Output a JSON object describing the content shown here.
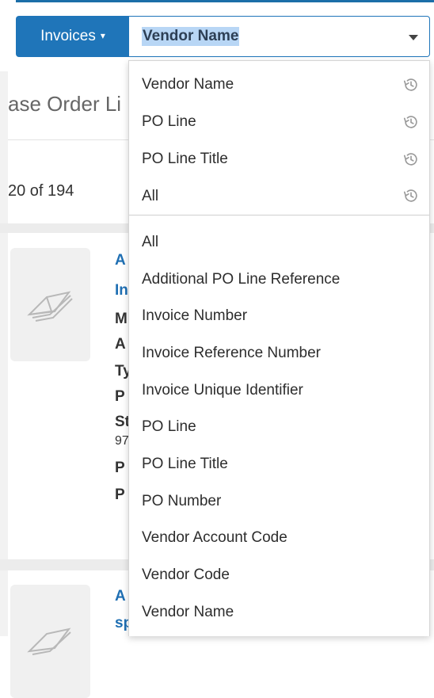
{
  "search": {
    "scope_label": "Invoices",
    "scope_caret": "▾",
    "selected_field": "Vendor Name"
  },
  "background": {
    "heading_fragment": "ase Order Li",
    "count_fragment": "20 of 194",
    "result1": {
      "title_line1": "A",
      "title_line2": "In",
      "fields": [
        "M",
        "A",
        "Ty",
        "P",
        "St",
        "97",
        "P",
        "P"
      ]
    },
    "result2": {
      "title_line1": "A",
      "title_line2": "sp"
    }
  },
  "dropdown": {
    "recent_items": [
      {
        "label": "Vendor Name",
        "icon": "history-icon"
      },
      {
        "label": "PO Line",
        "icon": "history-icon"
      },
      {
        "label": "PO Line Title",
        "icon": "history-icon"
      },
      {
        "label": "All",
        "icon": "history-icon"
      }
    ],
    "field_items": [
      "All",
      "Additional PO Line Reference",
      "Invoice Number",
      "Invoice Reference Number",
      "Invoice Unique Identifier",
      "PO Line",
      "PO Line Title",
      "PO Number",
      "Vendor Account Code",
      "Vendor Code",
      "Vendor Name"
    ]
  },
  "colors": {
    "accent": "#1f75b9",
    "selection_highlight": "#b8d6f5",
    "link": "#1f6fb3"
  }
}
